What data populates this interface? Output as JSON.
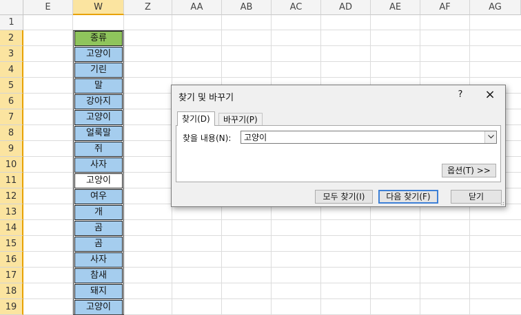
{
  "columns": [
    {
      "label": "E"
    },
    {
      "label": "W",
      "selected": true
    },
    {
      "label": "Z"
    },
    {
      "label": "AA"
    },
    {
      "label": "AB"
    },
    {
      "label": "AC"
    },
    {
      "label": "AD"
    },
    {
      "label": "AE"
    },
    {
      "label": "AF"
    },
    {
      "label": "AG"
    }
  ],
  "rows": [
    {
      "num": "1",
      "w": ""
    },
    {
      "num": "2",
      "w": "종류",
      "style": "header"
    },
    {
      "num": "3",
      "w": "고양이",
      "style": "blue"
    },
    {
      "num": "4",
      "w": "기린",
      "style": "blue"
    },
    {
      "num": "5",
      "w": "말",
      "style": "blue"
    },
    {
      "num": "6",
      "w": "강아지",
      "style": "blue"
    },
    {
      "num": "7",
      "w": "고양이",
      "style": "blue"
    },
    {
      "num": "8",
      "w": "얼룩말",
      "style": "blue"
    },
    {
      "num": "9",
      "w": "쥐",
      "style": "blue"
    },
    {
      "num": "10",
      "w": "사자",
      "style": "blue"
    },
    {
      "num": "11",
      "w": "고양이",
      "style": "active"
    },
    {
      "num": "12",
      "w": "여우",
      "style": "blue"
    },
    {
      "num": "13",
      "w": "개",
      "style": "blue"
    },
    {
      "num": "14",
      "w": "곰",
      "style": "blue"
    },
    {
      "num": "15",
      "w": "곰",
      "style": "blue"
    },
    {
      "num": "16",
      "w": "사자",
      "style": "blue"
    },
    {
      "num": "17",
      "w": "참새",
      "style": "blue"
    },
    {
      "num": "18",
      "w": "돼지",
      "style": "blue"
    },
    {
      "num": "19",
      "w": "고양이",
      "style": "blue"
    }
  ],
  "colors": {
    "header_cell": "#8fc45c",
    "data_cell": "#a5cdee",
    "selected_header": "#fbe4a0",
    "selected_header_border": "#e8a202",
    "default_button_border": "#3c7fd6"
  },
  "dialog": {
    "title": "찾기 및 바꾸기",
    "help": "?",
    "close_icon": "×",
    "tabs": {
      "find": "찾기(D)",
      "replace": "바꾸기(P)"
    },
    "find_label": "찾을 내용(N):",
    "find_value": "고양이",
    "options_button": "옵션(T) >>",
    "find_all_button": "모두 찾기(I)",
    "find_next_button": "다음 찾기(F)",
    "close_button": "닫기"
  }
}
